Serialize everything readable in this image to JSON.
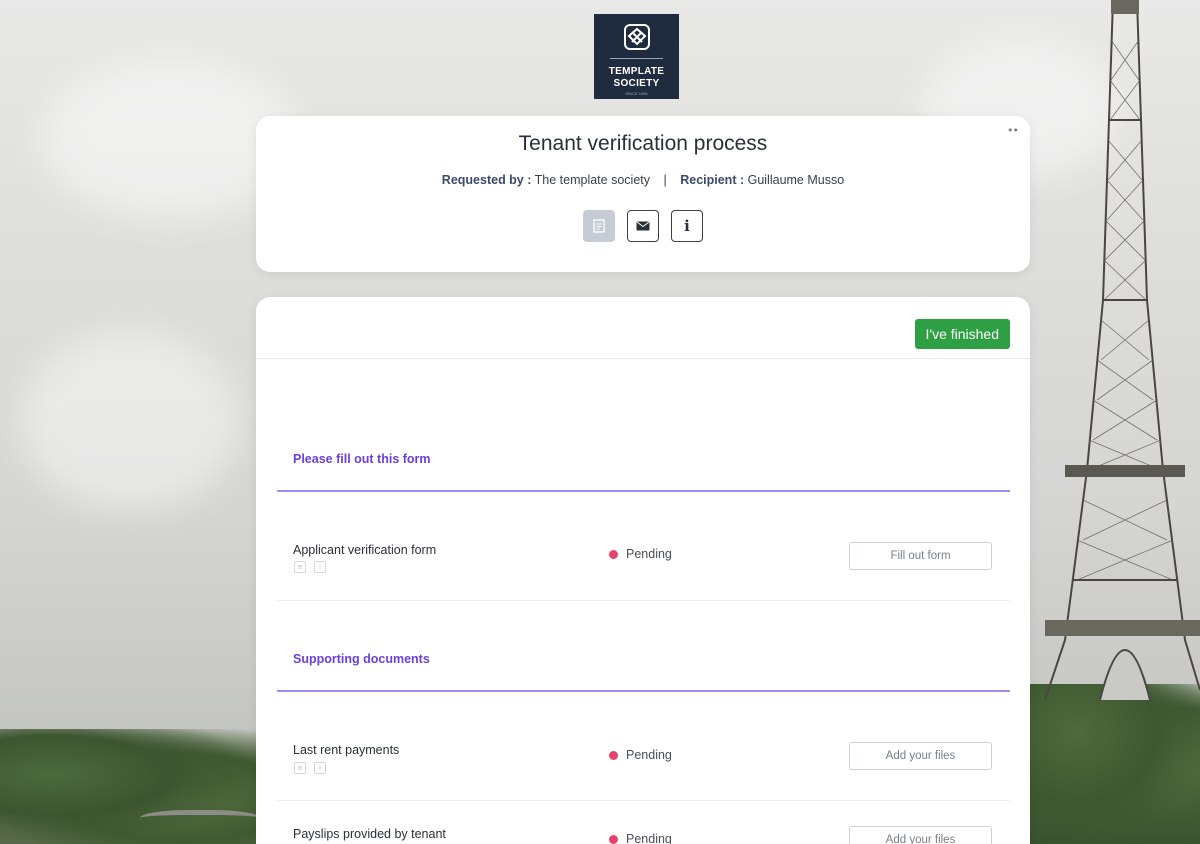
{
  "logo": {
    "line1": "TEMPLATE",
    "line2": "SOCIETY",
    "line3": "SINCE 1986"
  },
  "header": {
    "title": "Tenant verification process",
    "requested_by_label": "Requested by :",
    "requested_by_value": "The template society",
    "separator": "|",
    "recipient_label": "Recipient :",
    "recipient_value": "Guillaume Musso",
    "menu_dots": "••",
    "icons": [
      "document-icon",
      "envelope-icon",
      "info-icon"
    ],
    "info_glyph": "i"
  },
  "main": {
    "finish_label": "I've finished",
    "sections": [
      {
        "title": "Please fill out this form"
      },
      {
        "title": "Supporting documents"
      }
    ],
    "rows": [
      {
        "title": "Applicant verification form",
        "status": "Pending",
        "action": "Fill out form"
      },
      {
        "title": "Last rent payments",
        "status": "Pending",
        "action": "Add your files"
      },
      {
        "title": "Payslips provided by tenant",
        "status": "Pending",
        "action": "Add your files"
      }
    ]
  },
  "colors": {
    "accent_purple": "#6a3fe0",
    "finish_green": "#2ea043",
    "pending_red": "#e5436b",
    "logo_navy": "#1f2b3e"
  }
}
